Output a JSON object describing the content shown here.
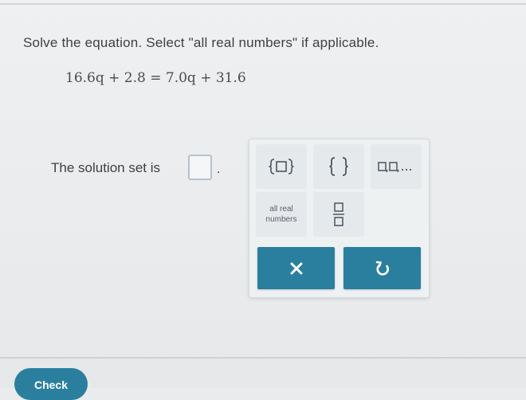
{
  "question": {
    "prompt": "Solve the equation. Select \"all real numbers\" if applicable.",
    "equation": "16.6q + 2.8 = 7.0q + 31.6"
  },
  "answer": {
    "label": "The solution set is",
    "suffix": "."
  },
  "palette": {
    "keys": [
      {
        "icon": "set-with-box-icon",
        "glyph": "{□}"
      },
      {
        "icon": "empty-set-braces-icon",
        "glyph": "{ }"
      },
      {
        "icon": "list-boxes-icon",
        "glyph": "□,□,..."
      },
      {
        "label": "all real numbers"
      },
      {
        "icon": "fraction-icon"
      }
    ],
    "clear_icon": "close-icon",
    "undo_icon": "undo-icon"
  },
  "footer": {
    "check_label": "Check"
  },
  "colors": {
    "accent": "#2a7f9e",
    "background": "#eceeef"
  }
}
